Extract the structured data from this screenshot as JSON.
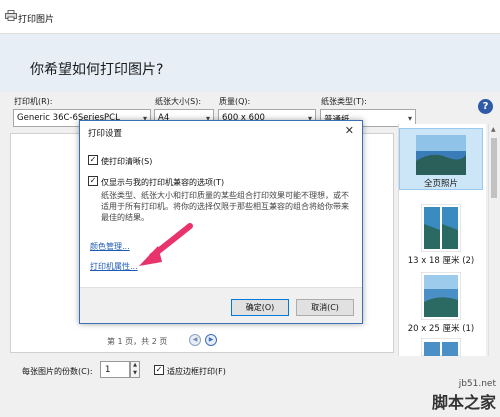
{
  "window": {
    "title": "打印图片"
  },
  "header": {
    "question": "你希望如何打印图片?"
  },
  "printer": {
    "label": "打印机(R):",
    "value": "Generic 36C-6SeriesPCL"
  },
  "paper_size": {
    "label": "纸张大小(S):",
    "value": "A4"
  },
  "quality": {
    "label": "质量(Q):",
    "value": "600 x 600"
  },
  "paper_type": {
    "label": "纸张类型(T):",
    "value": "普通纸"
  },
  "preview": {
    "page_info": "第 1 页，共 2 页"
  },
  "layouts": {
    "items": [
      {
        "caption": "全页照片",
        "selected": true
      },
      {
        "caption": "13 x 18 厘米 (2)"
      },
      {
        "caption": "20 x 25 厘米 (1)"
      }
    ]
  },
  "footer": {
    "copies_label": "每张图片的份数(C):",
    "copies_value": "1",
    "fit_label": "适应边框打印(F)"
  },
  "dialog": {
    "title": "打印设置",
    "option1": "使打印清晰(S)",
    "option2": "仅显示与我的打印机兼容的选项(T)",
    "description": "纸张类型、纸张大小和打印质量的某些组合打印效果可能不理想，或不适用于所有打印机。将你的选择仅限于那些相互兼容的组合将给你带来最佳的结果。",
    "color_link": "颜色管理...",
    "printer_props_link": "打印机属性...",
    "ok": "确定(O)",
    "cancel": "取消(C)"
  },
  "watermark": {
    "line1": "jb51.net",
    "line2": "脚本之家"
  },
  "colors": {
    "accent": "#0078d7",
    "arrow": "#e8336d",
    "header_bg": "#e7eef6"
  }
}
